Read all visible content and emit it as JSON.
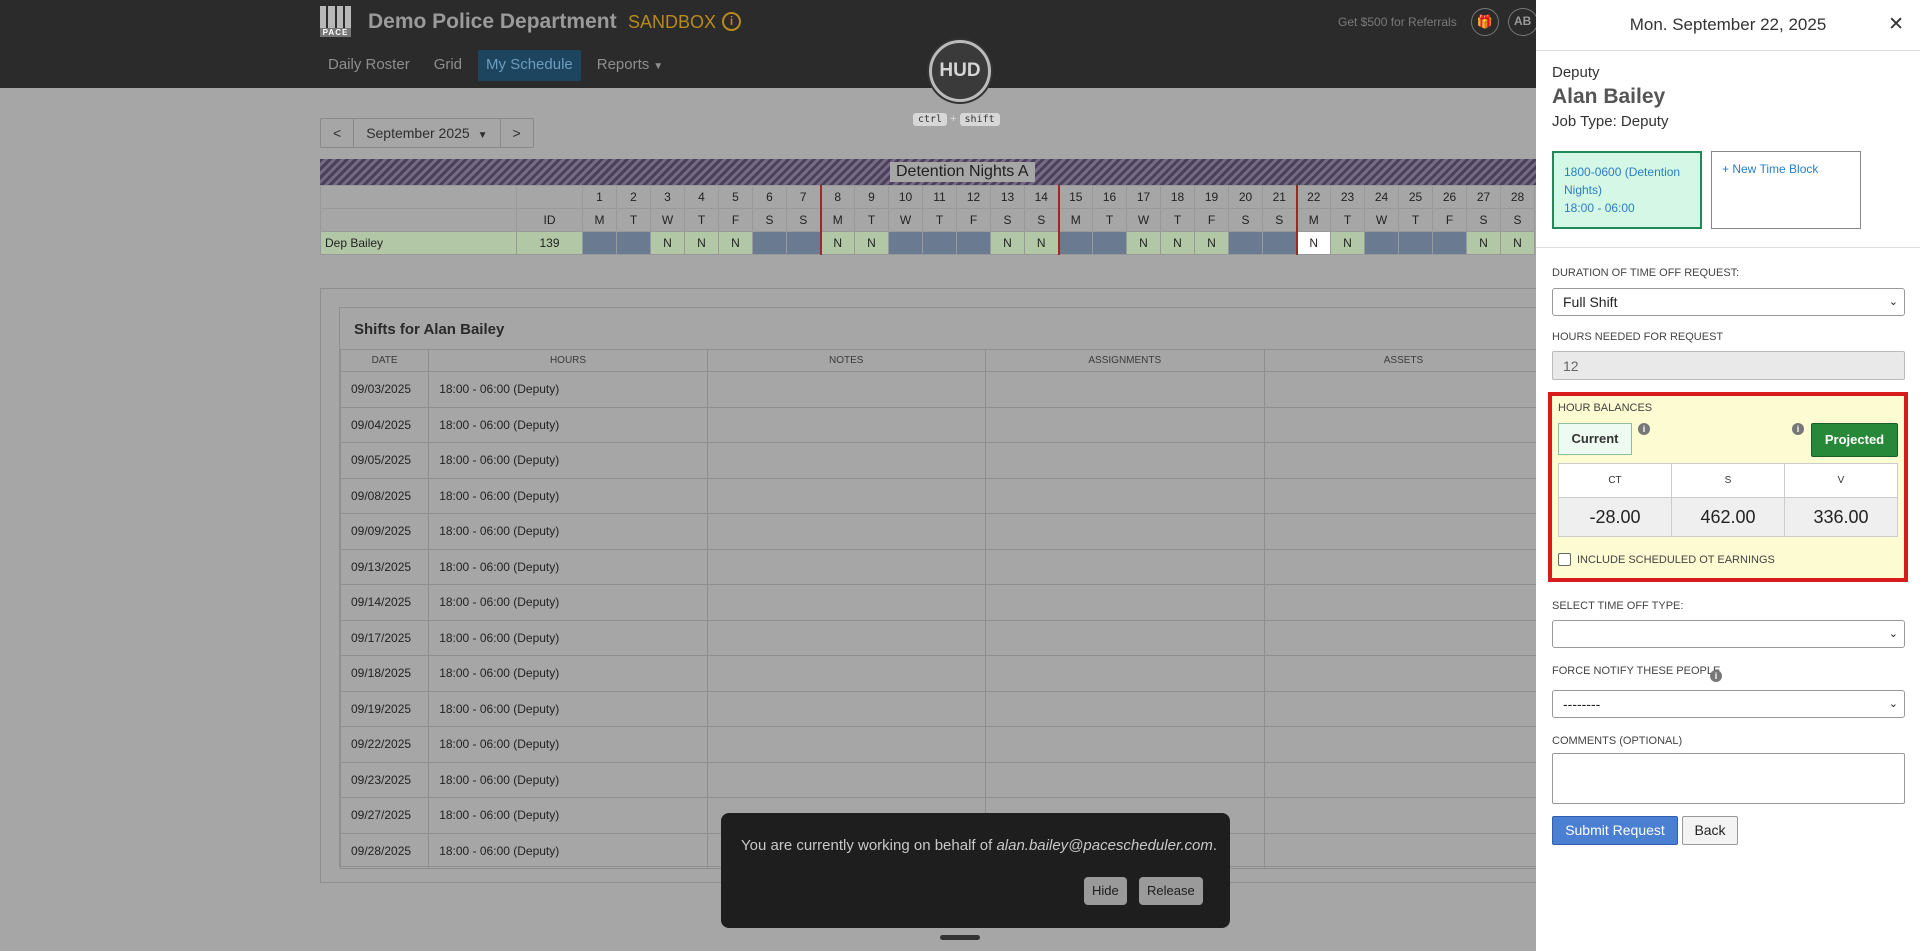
{
  "header": {
    "logo_text": "PACE",
    "org_name": "Demo Police Department",
    "env_badge": "SANDBOX",
    "referral_text": "Get $500 for Referrals",
    "avatar_initials": "AB"
  },
  "nav": {
    "items": [
      {
        "label": "Daily Roster"
      },
      {
        "label": "Grid"
      },
      {
        "label": "My Schedule",
        "active": true
      },
      {
        "label": "Reports",
        "has_dropdown": true
      }
    ]
  },
  "hud": {
    "label": "HUD",
    "key1": "ctrl",
    "plus": "+",
    "key2": "shift"
  },
  "month_nav": {
    "prev": "<",
    "month": "September 2025",
    "next": ">"
  },
  "grid": {
    "title": "Detention Nights A",
    "id_header": "ID",
    "days": [
      "1",
      "2",
      "3",
      "4",
      "5",
      "6",
      "7",
      "8",
      "9",
      "10",
      "11",
      "12",
      "13",
      "14",
      "15",
      "16",
      "17",
      "18",
      "19",
      "20",
      "21",
      "22",
      "23",
      "24",
      "25",
      "26",
      "27",
      "28"
    ],
    "weekdays": [
      "M",
      "T",
      "W",
      "T",
      "F",
      "S",
      "S",
      "M",
      "T",
      "W",
      "T",
      "F",
      "S",
      "S",
      "M",
      "T",
      "W",
      "T",
      "F",
      "S",
      "S",
      "M",
      "T",
      "W",
      "T",
      "F",
      "S",
      "S"
    ],
    "row": {
      "name": "Dep Bailey",
      "id": "139",
      "cells": [
        "",
        "",
        "N",
        "N",
        "N",
        "",
        "",
        "N",
        "N",
        "",
        "",
        "",
        "N",
        "N",
        "",
        "",
        "N",
        "N",
        "N",
        "",
        "",
        "N",
        "N",
        "",
        "",
        "",
        "N",
        "N"
      ]
    },
    "today_index": 21
  },
  "shifts": {
    "title": "Shifts for Alan Bailey",
    "columns": [
      "DATE",
      "HOURS",
      "NOTES",
      "ASSIGNMENTS",
      "ASSETS"
    ],
    "rows": [
      {
        "date": "09/03/2025",
        "hours": "18:00 - 06:00 (Deputy)"
      },
      {
        "date": "09/04/2025",
        "hours": "18:00 - 06:00 (Deputy)"
      },
      {
        "date": "09/05/2025",
        "hours": "18:00 - 06:00 (Deputy)"
      },
      {
        "date": "09/08/2025",
        "hours": "18:00 - 06:00 (Deputy)"
      },
      {
        "date": "09/09/2025",
        "hours": "18:00 - 06:00 (Deputy)"
      },
      {
        "date": "09/13/2025",
        "hours": "18:00 - 06:00 (Deputy)"
      },
      {
        "date": "09/14/2025",
        "hours": "18:00 - 06:00 (Deputy)"
      },
      {
        "date": "09/17/2025",
        "hours": "18:00 - 06:00 (Deputy)"
      },
      {
        "date": "09/18/2025",
        "hours": "18:00 - 06:00 (Deputy)"
      },
      {
        "date": "09/19/2025",
        "hours": "18:00 - 06:00 (Deputy)"
      },
      {
        "date": "09/22/2025",
        "hours": "18:00 - 06:00 (Deputy)"
      },
      {
        "date": "09/23/2025",
        "hours": "18:00 - 06:00 (Deputy)"
      },
      {
        "date": "09/27/2025",
        "hours": "18:00 - 06:00 (Deputy)"
      },
      {
        "date": "09/28/2025",
        "hours": "18:00 - 06:00 (Deputy)"
      }
    ]
  },
  "toast": {
    "message_prefix": "You are currently working on behalf of ",
    "email": "alan.bailey@pacescheduler.com",
    "message_suffix": ".",
    "hide_label": "Hide",
    "release_label": "Release"
  },
  "drawer": {
    "date_title": "Mon. September 22, 2025",
    "close_glyph": "✕",
    "role": "Deputy",
    "name": "Alan Bailey",
    "job_type": "Job Type: Deputy",
    "time_block": {
      "line1": "1800-0600 (Detention",
      "line2": "Nights)",
      "line3": "18:00 - 06:00"
    },
    "new_block_label": "+ New Time Block",
    "duration_label": "DURATION OF TIME OFF REQUEST:",
    "duration_value": "Full Shift",
    "hours_label": "HOURS NEEDED FOR REQUEST",
    "hours_value": "12",
    "balances": {
      "label": "HOUR BALANCES",
      "current_label": "Current",
      "projected_label": "Projected",
      "columns": [
        "CT",
        "S",
        "V"
      ],
      "values": [
        "-28.00",
        "462.00",
        "336.00"
      ],
      "ot_label": "INCLUDE SCHEDULED OT EARNINGS",
      "highlight_color": "#d81b1b"
    },
    "type_label": "SELECT TIME OFF TYPE:",
    "type_value": "",
    "notify_label": "FORCE NOTIFY THESE PEOPLE",
    "notify_value": "--------",
    "comments_label": "COMMENTS (OPTIONAL)",
    "submit_label": "Submit Request",
    "back_label": "Back"
  },
  "colors": {
    "accent": "#4a7fd1",
    "success": "#28883a",
    "topbar": "#2b2b2b",
    "sandbox": "#b88a1c"
  }
}
